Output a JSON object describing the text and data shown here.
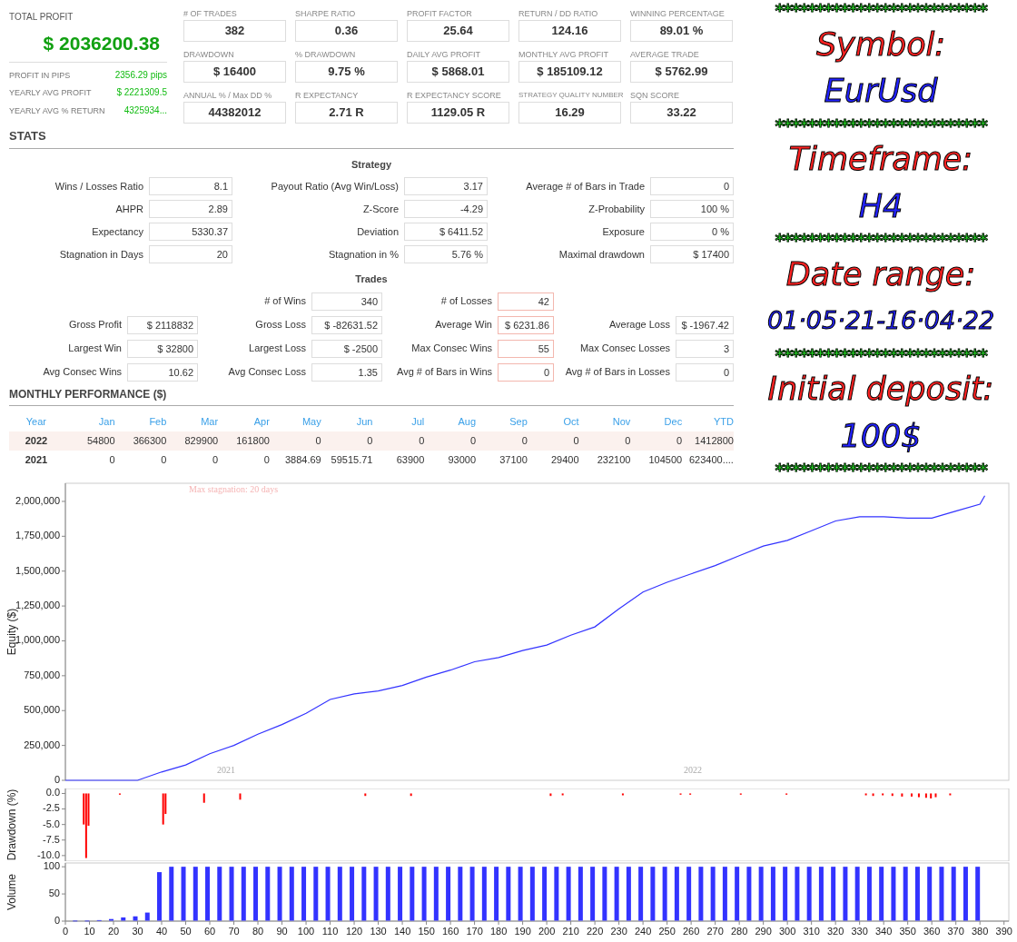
{
  "summary": {
    "total_profit": {
      "label": "TOTAL PROFIT",
      "value": "$ 2036200.38"
    },
    "rows": [
      {
        "label": "PROFIT IN PIPS",
        "value": "2356.29 pips"
      },
      {
        "label": "YEARLY AVG PROFIT",
        "value": "$ 2221309.5"
      },
      {
        "label": "YEARLY AVG % RETURN",
        "value": "4325934..."
      }
    ]
  },
  "metrics": [
    {
      "label": "# OF TRADES",
      "value": "382"
    },
    {
      "label": "SHARPE RATIO",
      "value": "0.36"
    },
    {
      "label": "PROFIT FACTOR",
      "value": "25.64"
    },
    {
      "label": "RETURN / DD RATIO",
      "value": "124.16"
    },
    {
      "label": "WINNING PERCENTAGE",
      "value": "89.01 %"
    },
    {
      "label": "DRAWDOWN",
      "value": "$ 16400"
    },
    {
      "label": "% DRAWDOWN",
      "value": "9.75 %"
    },
    {
      "label": "DAILY AVG PROFIT",
      "value": "$ 5868.01"
    },
    {
      "label": "MONTHLY AVG PROFIT",
      "value": "$ 185109.12"
    },
    {
      "label": "AVERAGE TRADE",
      "value": "$ 5762.99"
    },
    {
      "label": "ANNUAL % / Max DD %",
      "value": "44382012"
    },
    {
      "label": "R EXPECTANCY",
      "value": "2.71 R"
    },
    {
      "label": "R EXPECTANCY SCORE",
      "value": "1129.05 R"
    },
    {
      "label": "STRATEGY QUALITY NUMBER",
      "value": "16.29"
    },
    {
      "label": "SQN SCORE",
      "value": "33.22"
    }
  ],
  "stats": {
    "title": "STATS",
    "strategy": {
      "title": "Strategy",
      "columns": [
        [
          {
            "label": "Wins / Losses Ratio",
            "value": "8.1"
          },
          {
            "label": "AHPR",
            "value": "2.89"
          },
          {
            "label": "Expectancy",
            "value": "5330.37"
          },
          {
            "label": "Stagnation in Days",
            "value": "20"
          }
        ],
        [
          {
            "label": "Payout Ratio (Avg Win/Loss)",
            "value": "3.17"
          },
          {
            "label": "Z-Score",
            "value": "-4.29"
          },
          {
            "label": "Deviation",
            "value": "$ 6411.52"
          },
          {
            "label": "Stagnation in %",
            "value": "5.76 %"
          }
        ],
        [
          {
            "label": "Average # of Bars in Trade",
            "value": "0"
          },
          {
            "label": "Z-Probability",
            "value": "100 %"
          },
          {
            "label": "Exposure",
            "value": "0 %"
          },
          {
            "label": "Maximal drawdown",
            "value": "$ 17400"
          }
        ]
      ]
    },
    "trades": {
      "title": "Trades",
      "columns": [
        [
          {
            "label": "Gross Profit",
            "value": "$ 2118832",
            "highlighted": false
          },
          {
            "label": "Largest Win",
            "value": "$ 32800",
            "highlighted": false
          },
          {
            "label": "Avg Consec Wins",
            "value": "10.62",
            "highlighted": false
          }
        ],
        [
          {
            "label": "# of Wins",
            "value": "340",
            "highlighted": false
          },
          {
            "label": "Gross Loss",
            "value": "$ -82631.52",
            "highlighted": false
          },
          {
            "label": "Largest Loss",
            "value": "$ -2500",
            "highlighted": false
          },
          {
            "label": "Avg Consec Loss",
            "value": "1.35",
            "highlighted": false
          }
        ],
        [
          {
            "label": "# of Losses",
            "value": "42",
            "highlighted": true
          },
          {
            "label": "Average Win",
            "value": "$ 6231.86",
            "highlighted": true
          },
          {
            "label": "Max Consec Wins",
            "value": "55",
            "highlighted": true
          },
          {
            "label": "Avg # of Bars in Wins",
            "value": "0",
            "highlighted": true
          }
        ],
        [
          {
            "label": "Average Loss",
            "value": "$ -1967.42",
            "highlighted": false
          },
          {
            "label": "Max Consec Losses",
            "value": "3",
            "highlighted": false
          },
          {
            "label": "Avg # of Bars in Losses",
            "value": "0",
            "highlighted": false
          }
        ]
      ]
    }
  },
  "monthly": {
    "title": "MONTHLY PERFORMANCE ($)",
    "columns": [
      "Year",
      "Jan",
      "Feb",
      "Mar",
      "Apr",
      "May",
      "Jun",
      "Jul",
      "Aug",
      "Sep",
      "Oct",
      "Nov",
      "Dec",
      "YTD"
    ],
    "rows": [
      [
        "2022",
        "54800",
        "366300",
        "829900",
        "161800",
        "0",
        "0",
        "0",
        "0",
        "0",
        "0",
        "0",
        "0",
        "1412800"
      ],
      [
        "2021",
        "0",
        "0",
        "0",
        "0",
        "3884.69",
        "59515.71",
        "63900",
        "93000",
        "37100",
        "29400",
        "232100",
        "104500",
        "623400...."
      ]
    ]
  },
  "info_panel": {
    "items": [
      {
        "kind": "divider",
        "text": "**************************"
      },
      {
        "kind": "label",
        "text": "Symbol:"
      },
      {
        "kind": "value",
        "text": "EurUsd"
      },
      {
        "kind": "divider",
        "text": "**************************"
      },
      {
        "kind": "label",
        "text": "Timeframe:"
      },
      {
        "kind": "value",
        "text": "H4"
      },
      {
        "kind": "divider",
        "text": "**************************"
      },
      {
        "kind": "label",
        "text": "Date range:"
      },
      {
        "kind": "value",
        "text": "01·05·21-16·04·22"
      },
      {
        "kind": "divider",
        "text": "**************************"
      },
      {
        "kind": "label",
        "text": "Initial deposit:"
      },
      {
        "kind": "value",
        "text": "100$"
      },
      {
        "kind": "divider",
        "text": "**************************"
      }
    ]
  },
  "equity_chart": {
    "chart_data": {
      "type": "line",
      "ylabel": "Equity ($)",
      "xlim": [
        0,
        392
      ],
      "ylim": [
        0,
        2130000
      ],
      "yticks": [
        {
          "value": 0,
          "label": "0"
        },
        {
          "value": 250000,
          "label": "250,000"
        },
        {
          "value": 500000,
          "label": "500,000"
        },
        {
          "value": 750000,
          "label": "750,000"
        },
        {
          "value": 1000000,
          "label": "1,000,000"
        },
        {
          "value": 1250000,
          "label": "1,250,000"
        },
        {
          "value": 1500000,
          "label": "1,500,000"
        },
        {
          "value": 1750000,
          "label": "1,750,000"
        },
        {
          "value": 2000000,
          "label": "2,000,000"
        }
      ],
      "x": [
        0,
        10,
        20,
        30,
        40,
        50,
        60,
        70,
        80,
        90,
        100,
        110,
        120,
        130,
        140,
        150,
        160,
        170,
        180,
        190,
        200,
        210,
        220,
        230,
        240,
        250,
        260,
        270,
        280,
        290,
        300,
        310,
        320,
        330,
        340,
        350,
        360,
        370,
        380,
        382
      ],
      "series": [
        {
          "color": "#3333ff",
          "values": [
            0,
            0,
            0,
            0,
            60000,
            110000,
            190000,
            250000,
            330000,
            400000,
            480000,
            580000,
            620000,
            640000,
            680000,
            740000,
            790000,
            850000,
            880000,
            930000,
            970000,
            1040000,
            1100000,
            1230000,
            1350000,
            1420000,
            1480000,
            1540000,
            1610000,
            1680000,
            1720000,
            1790000,
            1860000,
            1890000,
            1890000,
            1880000,
            1880000,
            1930000,
            1980000,
            2040000
          ]
        }
      ],
      "annotations": [
        "Max stagnation: 20 days",
        "2021",
        "2022"
      ]
    }
  },
  "drawdown_chart": {
    "chart_data": {
      "type": "bar",
      "ylabel": "Drawdown (%)",
      "xlim": [
        0,
        392
      ],
      "ylim": [
        -10.9,
        0.8
      ],
      "yticks": [
        {
          "value": 0,
          "label": "0.0"
        },
        {
          "value": -2.5,
          "label": "-2.5"
        },
        {
          "value": -5,
          "label": "-5.0"
        },
        {
          "value": -7.5,
          "label": "-7.5"
        },
        {
          "value": -10,
          "label": "-10.0"
        }
      ],
      "x": [
        8,
        9,
        10,
        23,
        41,
        42,
        58,
        73,
        125,
        144,
        202,
        207,
        232,
        256,
        260,
        281,
        300,
        333,
        336,
        340,
        344,
        348,
        352,
        355,
        358,
        360,
        362,
        368
      ],
      "series": [
        {
          "color": "#ff0000",
          "values": [
            -5,
            -10.4,
            -5.2,
            -0.2,
            -5,
            -3.3,
            -1.5,
            -1,
            -0.4,
            -0.4,
            -0.4,
            -0.3,
            -0.3,
            -0.2,
            -0.2,
            -0.2,
            -0.2,
            -0.3,
            -0.4,
            -0.3,
            -0.4,
            -0.5,
            -0.5,
            -0.6,
            -0.7,
            -0.8,
            -0.6,
            -0.3
          ]
        }
      ]
    }
  },
  "volume_chart": {
    "chart_data": {
      "type": "bar",
      "ylabel": "Volume",
      "xlim": [
        0,
        392
      ],
      "ylim": [
        0,
        107
      ],
      "yticks": [
        0,
        50,
        100
      ],
      "xticks": [
        0,
        10,
        20,
        30,
        40,
        50,
        60,
        70,
        80,
        90,
        100,
        110,
        120,
        130,
        140,
        150,
        160,
        170,
        180,
        190,
        200,
        210,
        220,
        230,
        240,
        250,
        260,
        270,
        280,
        290,
        300,
        310,
        320,
        330,
        340,
        350,
        360,
        370,
        380,
        390
      ],
      "x": [
        5,
        10,
        15,
        20,
        25,
        30,
        35,
        40,
        45,
        50,
        55,
        60,
        65,
        70,
        75,
        80,
        85,
        90,
        95,
        100,
        105,
        110,
        115,
        120,
        125,
        130,
        135,
        140,
        145,
        150,
        155,
        160,
        165,
        170,
        175,
        180,
        185,
        190,
        195,
        200,
        205,
        210,
        215,
        220,
        225,
        230,
        235,
        240,
        245,
        250,
        255,
        260,
        265,
        270,
        275,
        280,
        285,
        290,
        295,
        300,
        305,
        310,
        315,
        320,
        325,
        330,
        335,
        340,
        345,
        350,
        355,
        360,
        365,
        370,
        375,
        380
      ],
      "series": [
        {
          "color": "#3333ff",
          "values": [
            0,
            0,
            1,
            3,
            6,
            8,
            15,
            90,
            100,
            100,
            100,
            100,
            100,
            100,
            100,
            100,
            100,
            100,
            100,
            100,
            100,
            100,
            100,
            100,
            100,
            100,
            100,
            100,
            100,
            100,
            100,
            100,
            100,
            100,
            100,
            100,
            100,
            100,
            100,
            100,
            100,
            100,
            100,
            100,
            100,
            100,
            100,
            100,
            100,
            100,
            100,
            100,
            100,
            100,
            100,
            100,
            100,
            100,
            100,
            100,
            100,
            100,
            100,
            100,
            100,
            100,
            100,
            100,
            100,
            100,
            100,
            100,
            100,
            100,
            100,
            100
          ]
        }
      ]
    }
  }
}
